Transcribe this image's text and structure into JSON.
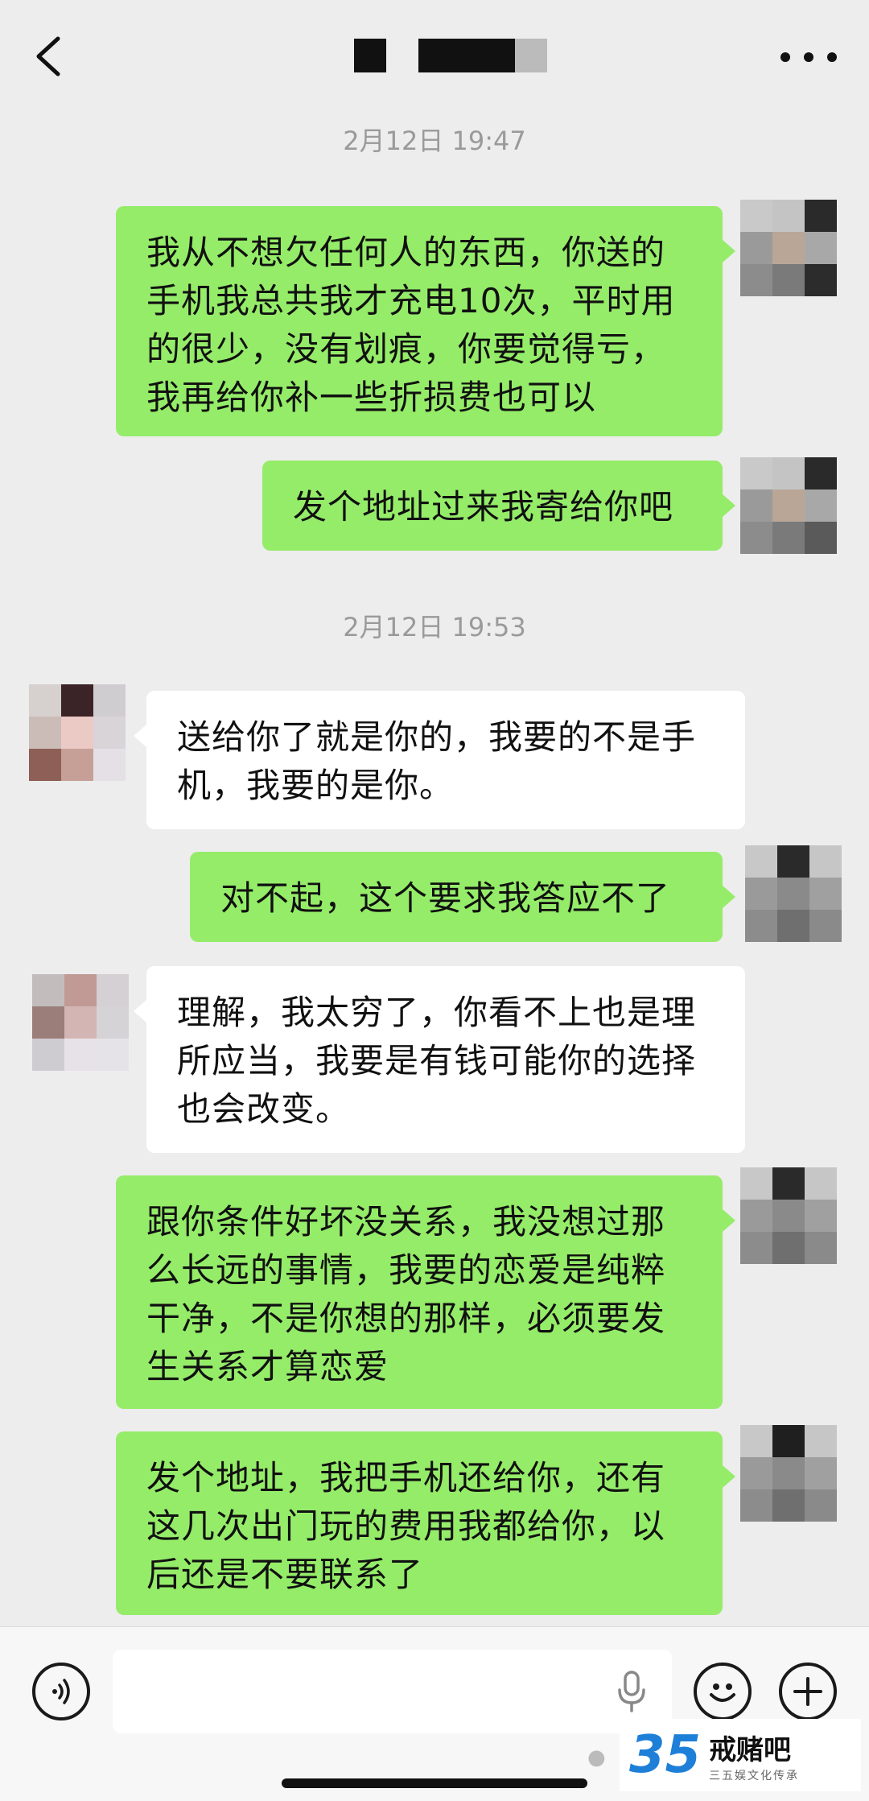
{
  "header": {
    "back_icon": "chevron-left-icon",
    "more_icon": "more-dots-icon"
  },
  "timestamps": [
    "2月12日 19:47",
    "2月12日 19:53"
  ],
  "messages": [
    {
      "side": "right",
      "lines": [
        "我从不想欠任何人的东西，你送的",
        "手机我总共我才充电10次，平时用",
        "的很少，没有划痕，你要觉得亏，",
        "我再给你补一些折损费也可以"
      ]
    },
    {
      "side": "right",
      "lines": [
        "发个地址过来我寄给你吧"
      ]
    },
    {
      "side": "left",
      "lines": [
        "送给你了就是你的，我要的不是手",
        "机，我要的是你。"
      ]
    },
    {
      "side": "right",
      "lines": [
        "对不起，这个要求我答应不了"
      ]
    },
    {
      "side": "left",
      "lines": [
        "理解，我太穷了，你看不上也是理",
        "所应当，我要是有钱可能你的选择",
        "也会改变。"
      ]
    },
    {
      "side": "right",
      "lines": [
        "跟你条件好坏没关系，我没想过那",
        "么长远的事情，我要的恋爱是纯粹",
        "干净，不是你想的那样，必须要发",
        "生关系才算恋爱"
      ]
    },
    {
      "side": "right",
      "lines": [
        "发个地址，我把手机还给你，还有",
        "这几次出门玩的费用我都给你，以",
        "后还是不要联系了"
      ]
    }
  ],
  "colors": {
    "background": "#ededed",
    "bubble_right": "#95ec69",
    "bubble_left": "#ffffff",
    "timestamp": "#9a9a9a"
  },
  "input_bar": {
    "voice_icon": "voice-icon",
    "mic_icon": "mic-icon",
    "emoji_icon": "emoji-icon",
    "plus_icon": "plus-icon"
  },
  "watermark": {
    "logo": "35",
    "title": "戒赌吧",
    "subtitle": "三五娱文化传承"
  }
}
